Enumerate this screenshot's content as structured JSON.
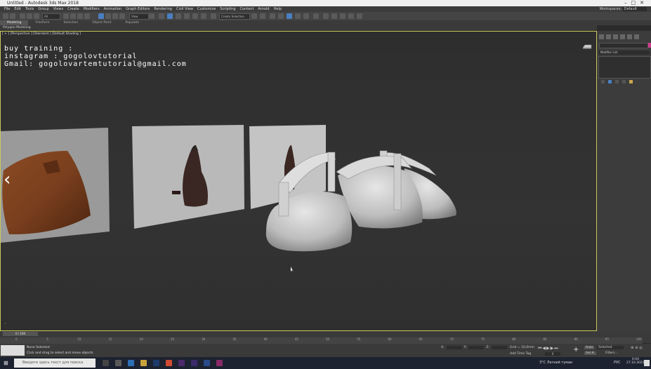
{
  "window": {
    "title": "Untitled - Autodesk 3ds Max 2018"
  },
  "menu": [
    "File",
    "Edit",
    "Tools",
    "Group",
    "Views",
    "Create",
    "Modifiers",
    "Animation",
    "Graph Editors",
    "Rendering",
    "Civil View",
    "Customize",
    "Scripting",
    "Content",
    "Arnold",
    "Help"
  ],
  "workspace": {
    "label": "Workspaces:",
    "value": "Default"
  },
  "toolbar": {
    "filter_value": "All",
    "view_value": "View",
    "selection_set": "Create Selection Set"
  },
  "ribbon": {
    "tabs": [
      "Modeling",
      "Freeform",
      "Selection",
      "Object Paint",
      "Populate"
    ],
    "subtitle": "Polygon Modeling"
  },
  "viewport": {
    "label": "[ + ] [Perspective ] [Standard ] [Default Shading ]"
  },
  "overlay": {
    "line1": "buy training :",
    "line2": "instagram : gogolovtutorial",
    "line3": "Gmail: gogolovartemtutorial@gmail.com"
  },
  "command_panel": {
    "modifier_list": "Modifier List"
  },
  "timeline": {
    "frame": "0 / 100",
    "ticks": [
      "0",
      "5",
      "10",
      "15",
      "20",
      "25",
      "30",
      "35",
      "40",
      "45",
      "50",
      "55",
      "60",
      "65",
      "70",
      "75",
      "80",
      "85",
      "90",
      "95",
      "100"
    ]
  },
  "status": {
    "selection": "None Selected",
    "prompt": "Click and drag to select and move objects",
    "grid": "Grid = 10,0mm",
    "add_time_tag": "Add Time Tag",
    "auto": "Auto",
    "selected": "Selected",
    "set_k": "Set K.",
    "filters": "Filters...",
    "x_label": "X:",
    "y_label": "Y:",
    "z_label": "Z:",
    "frame_value": "0"
  },
  "taskbar": {
    "search_placeholder": "Введите здесь текст для поиска",
    "weather": "3°C  Легкий туман",
    "lang": "РУС",
    "time": "0:04",
    "date": "27.10.2021"
  },
  "colors": {
    "accent": "#4a7fc1",
    "viewport_border": "#c9c95a",
    "bag_leather": "#7a3f1e",
    "bag_dark": "#3a2622"
  }
}
